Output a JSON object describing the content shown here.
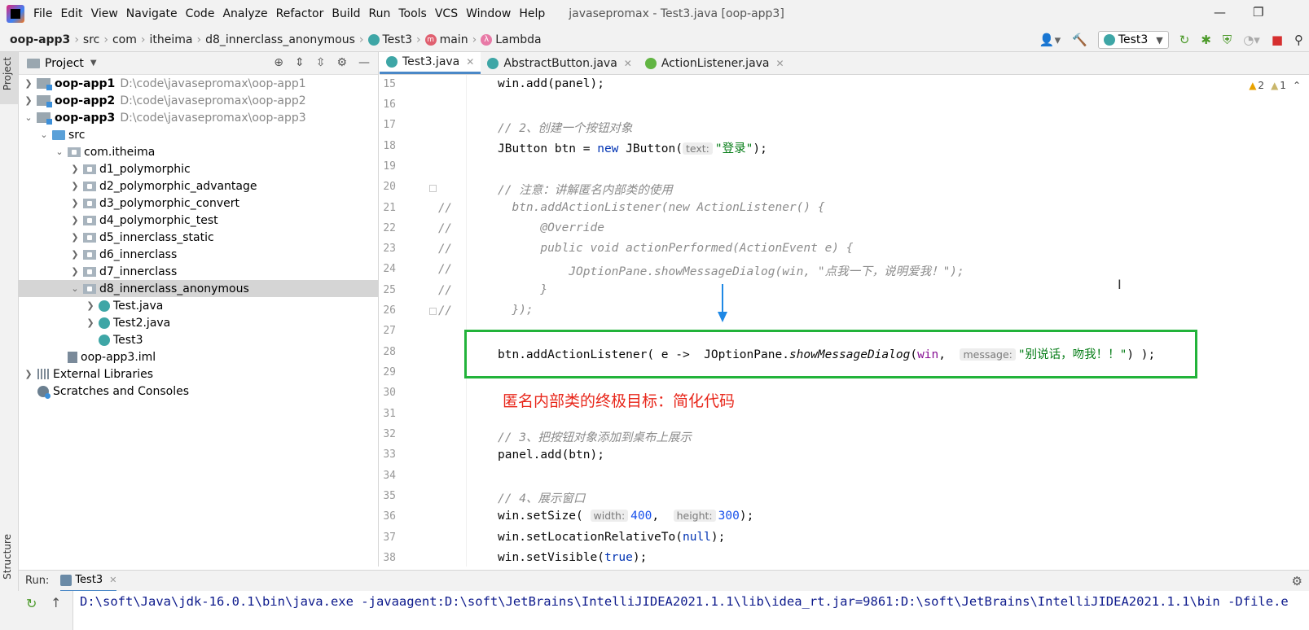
{
  "menubar": {
    "items": [
      "File",
      "Edit",
      "View",
      "Navigate",
      "Code",
      "Analyze",
      "Refactor",
      "Build",
      "Run",
      "Tools",
      "VCS",
      "Window",
      "Help"
    ],
    "title": "javasepromax - Test3.java [oop-app3]"
  },
  "breadcrumb": [
    "oop-app3",
    "src",
    "com",
    "itheima",
    "d8_innerclass_anonymous",
    "Test3",
    "main",
    "Lambda"
  ],
  "toolbar": {
    "run_config": "Test3"
  },
  "project_panel": {
    "title": "Project",
    "tree": [
      {
        "name": "oop-app1",
        "path": "D:\\code\\javasepromax\\oop-app1"
      },
      {
        "name": "oop-app2",
        "path": "D:\\code\\javasepromax\\oop-app2"
      },
      {
        "name": "oop-app3",
        "path": "D:\\code\\javasepromax\\oop-app3"
      },
      {
        "name": "src"
      },
      {
        "name": "com.itheima"
      },
      {
        "name": "d1_polymorphic"
      },
      {
        "name": "d2_polymorphic_advantage"
      },
      {
        "name": "d3_polymorphic_convert"
      },
      {
        "name": "d4_polymorphic_test"
      },
      {
        "name": "d5_innerclass_static"
      },
      {
        "name": "d6_innerclass"
      },
      {
        "name": "d7_innerclass"
      },
      {
        "name": "d8_innerclass_anonymous"
      },
      {
        "name": "Test.java"
      },
      {
        "name": "Test2.java"
      },
      {
        "name": "Test3"
      },
      {
        "name": "oop-app3.iml"
      },
      {
        "name": "External Libraries"
      },
      {
        "name": "Scratches and Consoles"
      }
    ]
  },
  "side_tabs": {
    "project": "Project",
    "structure": "Structure"
  },
  "editor": {
    "tabs": [
      "Test3.java",
      "AbstractButton.java",
      "ActionListener.java"
    ],
    "warnings": "2",
    "weak_warnings": "1",
    "line_numbers": [
      "15",
      "16",
      "17",
      "18",
      "19",
      "20",
      "21",
      "22",
      "23",
      "24",
      "25",
      "26",
      "27",
      "28",
      "29",
      "30",
      "31",
      "32",
      "33",
      "34",
      "35",
      "36",
      "37",
      "38"
    ],
    "code": {
      "l15": "win.add(panel);",
      "l17": "// 2、创建一个按钮对象",
      "l18_a": "JButton btn = ",
      "l18_kw": "new",
      "l18_b": " JButton(",
      "l18_hint": "text:",
      "l18_str": "\"登录\"",
      "l18_c": ");",
      "l20": "// 注意：讲解匿名内部类的使用",
      "l21": "  btn.addActionListener(new ActionListener() {",
      "l22": "      @Override",
      "l23": "      public void actionPerformed(ActionEvent e) {",
      "l24": "          JOptionPane.showMessageDialog(win, \"点我一下，说明爱我！\");",
      "l25": "      }",
      "l26": "  });",
      "l28_a": "btn.addActionListener( e ->  JOptionPane.",
      "l28_m": "showMessageDialog",
      "l28_b": "(",
      "l28_win": "win",
      "l28_c": ",  ",
      "l28_hint": "message:",
      "l28_str": "\"别说话，吻我！！\"",
      "l28_d": ") );",
      "l32": "// 3、把按钮对象添加到桌布上展示",
      "l33": "panel.add(btn);",
      "l35": "// 4、展示窗口",
      "l36_a": "win.setSize( ",
      "l36_h1": "width:",
      "l36_n1": "400",
      "l36_b": ",  ",
      "l36_h2": "height:",
      "l36_n2": "300",
      "l36_c": ");",
      "l37_a": "win.setLocationRelativeTo(",
      "l37_kw": "null",
      "l37_b": ");",
      "l38_a": "win.setVisible(",
      "l38_kw": "true",
      "l38_b": ");"
    },
    "comment_marker": "//",
    "annotation": "匿名内部类的终极目标：简化代码"
  },
  "run_panel": {
    "label": "Run:",
    "tab": "Test3",
    "output": "D:\\soft\\Java\\jdk-16.0.1\\bin\\java.exe -javaagent:D:\\soft\\JetBrains\\IntelliJIDEA2021.1.1\\lib\\idea_rt.jar=9861:D:\\soft\\JetBrains\\IntelliJIDEA2021.1.1\\bin -Dfile.e"
  },
  "colors": {
    "highlight_box": "#22b33a",
    "annotation": "#e8271b",
    "arrow": "#1e88e5"
  }
}
